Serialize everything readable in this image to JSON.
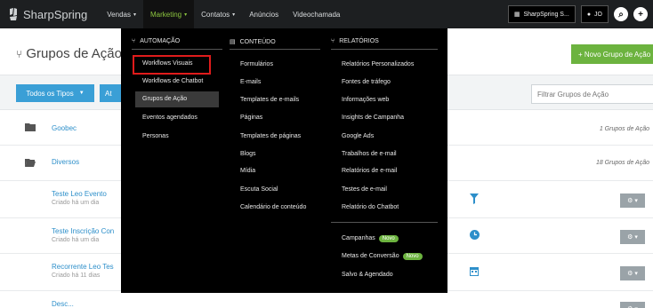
{
  "brand": {
    "name": "SharpSpring"
  },
  "nav": [
    {
      "label": "Vendas",
      "caret": "⌄"
    },
    {
      "label": "Marketing",
      "caret": "⌄"
    },
    {
      "label": "Contatos",
      "caret": "⌄"
    },
    {
      "label": "Anúncios"
    },
    {
      "label": "Videochamada"
    }
  ],
  "account": {
    "label": "SharpSpring S...",
    "user": "JO"
  },
  "page": {
    "title": "Grupos de Ação c",
    "new_button": "+ Novo Grupo de Ação",
    "types_button": "Todos os Tipos",
    "types_button2": "At",
    "filter_placeholder": "Filtrar Grupos de Ação"
  },
  "folders": [
    {
      "name": "Goobec",
      "count": "1 Grupos de Ação"
    },
    {
      "name": "Diversos",
      "count": "18 Grupos de Ação"
    }
  ],
  "items": [
    {
      "name": "Teste Leo Evento",
      "sub": "Criado há um dia",
      "icon": "filter-icon"
    },
    {
      "name": "Teste Inscrição Con",
      "sub": "Criado há um dia",
      "icon": "clock-icon"
    },
    {
      "name": "Recorrente Leo Tes",
      "sub": "Criado há 11 dias",
      "icon": "calendar-icon"
    }
  ],
  "partial_row": "Desc...",
  "menu": {
    "automacao": {
      "title": "Automação",
      "items": [
        "Workflows Visuais",
        "Workflows de Chatbot",
        "Grupos de Ação",
        "Eventos agendados",
        "Personas"
      ],
      "highlighted": "Workflows Visuais",
      "selected": "Grupos de Ação"
    },
    "conteudo": {
      "title": "Conteúdo",
      "items": [
        "Formulários",
        "E-mails",
        "Templates de e-mails",
        "Páginas",
        "Templates de páginas",
        "Blogs",
        "Mídia",
        "Escuta Social",
        "Calendário de conteúdo"
      ]
    },
    "relatorios": {
      "title": "Relatórios",
      "items": [
        "Relatórios Personalizados",
        "Fontes de tráfego",
        "Informações web",
        "Insights de Campanha",
        "Google Ads",
        "Trabalhos de e-mail",
        "Relatórios de e-mail",
        "Testes de e-mail",
        "Relatório do Chatbot"
      ]
    },
    "extra": [
      {
        "label": "Campanhas",
        "badge": "Novo"
      },
      {
        "label": "Metas de Conversão",
        "badge": "Novo"
      },
      {
        "label": "Salvo & Agendado"
      }
    ]
  },
  "colors": {
    "accent_green": "#6cb33f",
    "link_blue": "#2d8fca",
    "highlight_red": "#e01b1b"
  }
}
